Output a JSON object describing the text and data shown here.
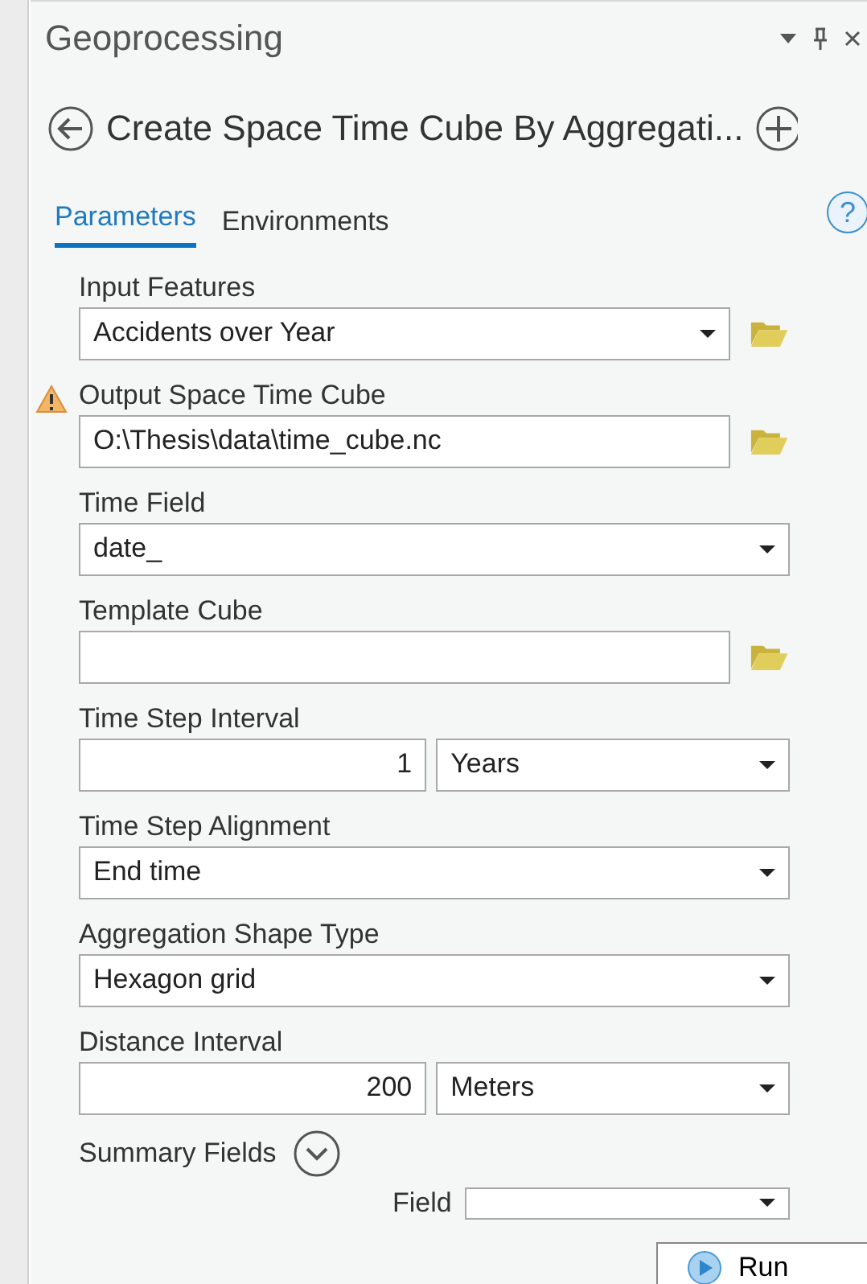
{
  "pane": {
    "title": "Geoprocessing"
  },
  "tool": {
    "title": "Create Space Time Cube By Aggregati..."
  },
  "tabs": [
    {
      "label": "Parameters",
      "selected": true
    },
    {
      "label": "Environments",
      "selected": false
    }
  ],
  "help": "?",
  "parameters": [
    {
      "label": "Input Features",
      "kind": "combo",
      "value": "Accidents over Year",
      "warning": false,
      "browse": true
    },
    {
      "label": "Output Space Time Cube",
      "kind": "text",
      "value": "O:\\Thesis\\data\\time_cube.nc",
      "warning": true,
      "browse": true
    },
    {
      "label": "Time Field",
      "kind": "combo",
      "value": "date_",
      "warning": false,
      "browse": false
    },
    {
      "label": "Template Cube",
      "kind": "text",
      "warning": false,
      "browse": true
    },
    {
      "label": "Time Step Interval",
      "kind": "pair",
      "value": "1",
      "unit": "Years",
      "warning": false,
      "browse": false
    },
    {
      "label": "Time Step Alignment",
      "kind": "combo",
      "value": "End time",
      "warning": false,
      "browse": false
    },
    {
      "label": "Aggregation Shape Type",
      "kind": "combo",
      "value": "Hexagon grid",
      "warning": false,
      "browse": false
    },
    {
      "label": "Distance Interval",
      "kind": "pair",
      "value": "200",
      "unit": "Meters",
      "warning": false,
      "browse": false
    }
  ],
  "summary_fields": {
    "label": "Summary Fields",
    "expanded": false,
    "field_label": "Field"
  },
  "run_button": "Run"
}
